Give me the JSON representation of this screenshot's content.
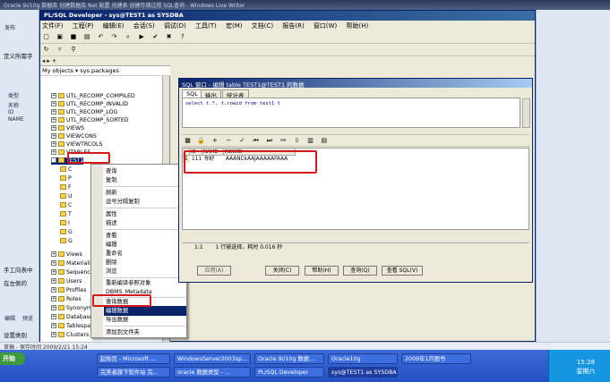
{
  "outer_window": {
    "title": "Oracle 9i/10g 数据库 创建数据库 Net 配置 创建表 创建存储过程 SQL查询 - Windows Live Writer"
  },
  "wlw": {
    "tabs": [
      "发布",
      "编辑",
      "预览"
    ],
    "side_labels": [
      "类型",
      "名称",
      "ID",
      "NAME",
      "ROWID"
    ],
    "doc_lines": [
      "定义所需字",
      "手工向表中",
      "在左侧的",
      "设置类别"
    ],
    "status": "草稿 - 保存时间 2009/2/21 15:24"
  },
  "plsql": {
    "title": "PL/SQL Developer - sys@TEST1 as SYSDBA",
    "menu": [
      "文件(F)",
      "工程(P)",
      "编辑(E)",
      "会话(S)",
      "调试(D)",
      "工具(T)",
      "宏(M)",
      "文档(C)",
      "报告(R)",
      "窗口(W)",
      "帮助(H)"
    ],
    "browser": {
      "header": "My objects ▾ sys.packages",
      "tree": [
        "UTL_RECOMP_COMPILED",
        "UTL_RECOMP_INVALID",
        "UTL_RECOMP_LOG",
        "UTL_RECOMP_SORTED",
        "VIEWS",
        "VIEWCONS",
        "VIEWTRCOLS",
        "VTABLES",
        "TEST1"
      ],
      "tree_lower": [
        "Views",
        "Materialized",
        "Sequences",
        "Users",
        "Profiles",
        "Roles",
        "Synonyms",
        "Database",
        "Tablespaces",
        "Clusters"
      ]
    },
    "context_menu": {
      "items": [
        "查询",
        "复制",
        "刷新",
        "逗号分隔复制",
        "属性",
        "描述",
        "查看",
        "编辑",
        "重命名",
        "删除",
        "浏览",
        "重新编译参照对象",
        "DBMS_Metadata",
        "查询数据",
        "编辑数据",
        "导出数据",
        "添加到文件夹"
      ],
      "selected": "编辑数据"
    }
  },
  "sql_window": {
    "title": "SQL 窗口 - 编辑 table TEST1@TEST1 的数据",
    "tabs": [
      "SQL",
      "输出",
      "统计表"
    ],
    "query": "select t.*, t.rowid from test1 t",
    "grid": {
      "headers": [
        "",
        "ID",
        "NAME",
        "ROWID"
      ],
      "row": {
        "index": "1",
        "id": "111",
        "name": "你好",
        "rowid": "AAANCkAAJAAAAAFAAA"
      }
    },
    "status_pos": "1:1",
    "status_text": "1 行被选择，耗时 0.016 秒",
    "buttons": [
      "应用(A)",
      "关闭(C)",
      "帮助(H)",
      "查询(Q)",
      "查看 SQL(V)"
    ]
  },
  "taskbar": {
    "start": "开始",
    "tasks_row1": [
      "起始页 - Microsoft ...",
      "WindowsServer2003sp...",
      "Oracle 9i/10g 数据...",
      "Oracle10g",
      "2009年1月图书"
    ],
    "tasks_row2": [
      "完美者旗下软件站 完...",
      "oracle 数据类型 - ...",
      "PL/SQL Developer",
      "sys@TEST1 as SYSDBA"
    ],
    "clock_time": "15:28",
    "clock_day": "星期六"
  },
  "colors": {
    "accent": "#0a246a",
    "highlight": "#d21a1a"
  }
}
